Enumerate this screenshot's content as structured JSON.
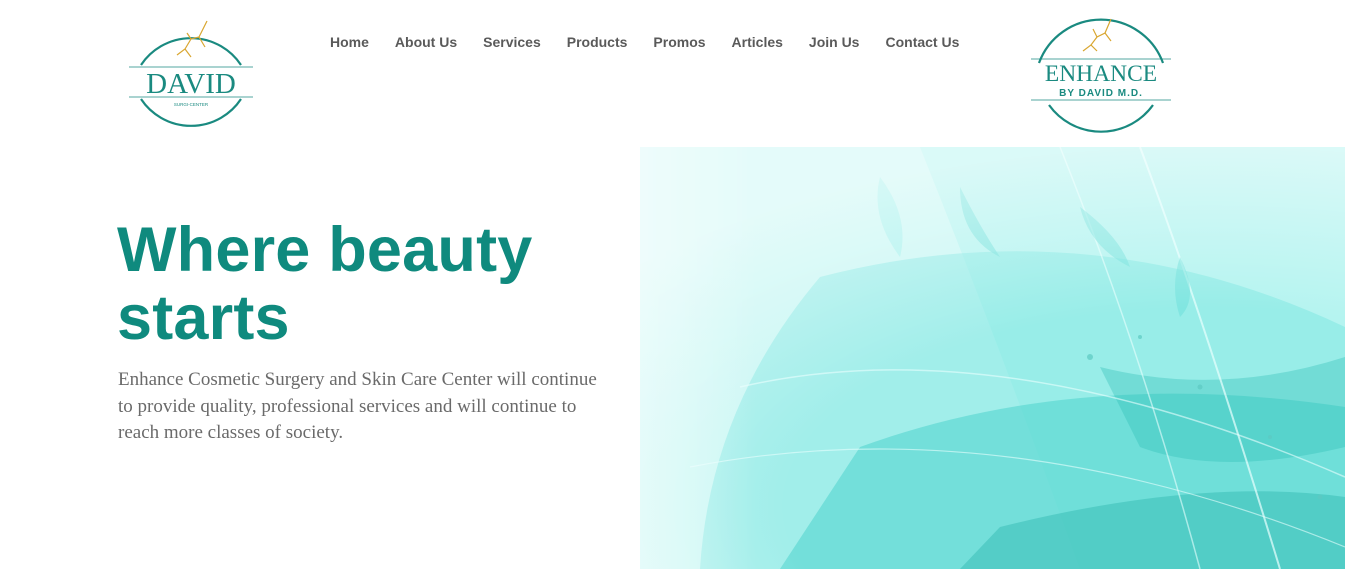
{
  "logos": {
    "left": {
      "name": "DAVID",
      "tagline": "SURGI-CENTER"
    },
    "right": {
      "name": "ENHANCE",
      "tagline": "BY DAVID M.D."
    }
  },
  "nav": {
    "items": [
      {
        "label": "Home"
      },
      {
        "label": "About Us"
      },
      {
        "label": "Services"
      },
      {
        "label": "Products"
      },
      {
        "label": "Promos"
      },
      {
        "label": "Articles"
      },
      {
        "label": "Join Us"
      },
      {
        "label": "Contact Us"
      }
    ]
  },
  "hero": {
    "title_line1": "Where beauty",
    "title_line2": "starts",
    "description": "Enhance Cosmetic Surgery and Skin Care Center will continue to provide quality, professional services and will continue to reach more classes of society."
  },
  "colors": {
    "brand_teal": "#0f8a7e",
    "nav_text": "#5a5a5a",
    "body_text": "#6a6a6a",
    "hero_accent": "#3fe0d8",
    "logo_gold": "#d9a630"
  }
}
